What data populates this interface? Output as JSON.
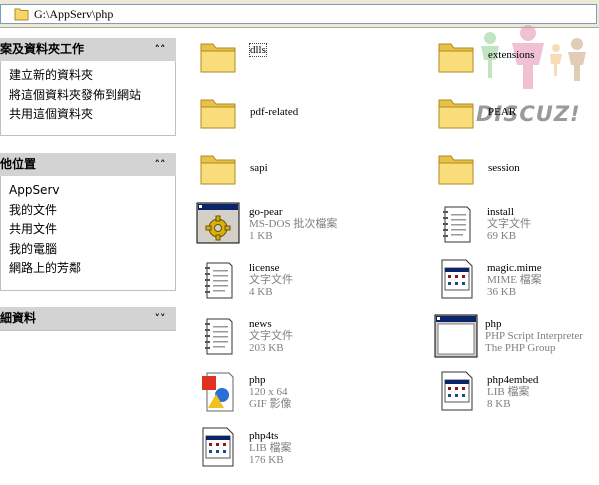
{
  "address_bar": {
    "path": "G:\\AppServ\\php"
  },
  "task_pane": {
    "file_tasks": {
      "title": "案及資料夾工作",
      "chevron": "«",
      "items": [
        "建立新的資料夾",
        "將這個資料夾發佈到網站",
        "共用這個資料夾"
      ]
    },
    "other_places": {
      "title": "他位置",
      "chevron": "«",
      "items": [
        "AppServ",
        "我的文件",
        "共用文件",
        "我的電腦",
        "網路上的芳鄰"
      ]
    },
    "details": {
      "title": "細資料",
      "chevron": "»"
    }
  },
  "files": [
    {
      "name": "dlls",
      "type": "folder"
    },
    {
      "name": "extensions",
      "type": "folder"
    },
    {
      "name": "pdf-related",
      "type": "folder"
    },
    {
      "name": "PEAR",
      "type": "folder"
    },
    {
      "name": "sapi",
      "type": "folder"
    },
    {
      "name": "session",
      "type": "folder"
    },
    {
      "name": "go-pear",
      "line2": "MS-DOS 批次檔案",
      "line3": "1 KB",
      "type": "batch"
    },
    {
      "name": "install",
      "line2": "文字文件",
      "line3": "69 KB",
      "type": "text"
    },
    {
      "name": "license",
      "line2": "文字文件",
      "line3": "4 KB",
      "type": "text"
    },
    {
      "name": "magic.mime",
      "line2": "MIME 檔案",
      "line3": "36 KB",
      "type": "generic"
    },
    {
      "name": "news",
      "line2": "文字文件",
      "line3": "203 KB",
      "type": "text"
    },
    {
      "name": "php",
      "line2": "PHP Script Interpreter",
      "line3": "The PHP Group",
      "type": "exe"
    },
    {
      "name": "php",
      "line2": "120 x 64",
      "line3": "GIF 影像",
      "type": "gif"
    },
    {
      "name": "php4embed",
      "line2": "LIB 檔案",
      "line3": "8 KB",
      "type": "generic"
    },
    {
      "name": "php4ts",
      "line2": "LIB 檔案",
      "line3": "176 KB",
      "type": "generic"
    }
  ],
  "watermark": {
    "text": "DISCUZ!"
  }
}
